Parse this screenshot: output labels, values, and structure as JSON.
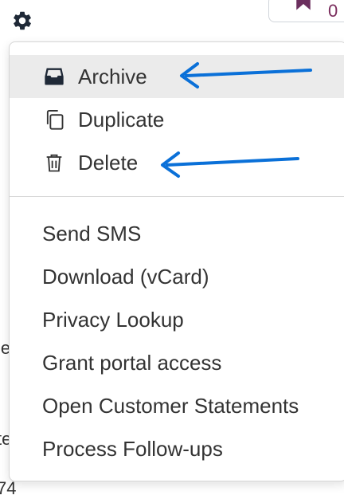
{
  "toolbar": {
    "gear_icon": "gear-icon",
    "star_icon": "star-icon",
    "star_count": "0"
  },
  "side_fragments": [
    "le",
    "te",
    "74"
  ],
  "menu": {
    "primary": [
      {
        "label": "Archive",
        "icon": "archive-icon",
        "active": true
      },
      {
        "label": "Duplicate",
        "icon": "duplicate-icon"
      },
      {
        "label": "Delete",
        "icon": "trash-icon"
      }
    ],
    "secondary": [
      {
        "label": "Send SMS"
      },
      {
        "label": "Download (vCard)"
      },
      {
        "label": "Privacy Lookup"
      },
      {
        "label": "Grant portal access"
      },
      {
        "label": "Open Customer Statements"
      },
      {
        "label": "Process Follow-ups"
      }
    ]
  },
  "colors": {
    "arrow": "#0a70d8",
    "hover_bg": "#ebebeb",
    "badge_text": "#7a2c5c",
    "star": "#6b2f5e"
  }
}
